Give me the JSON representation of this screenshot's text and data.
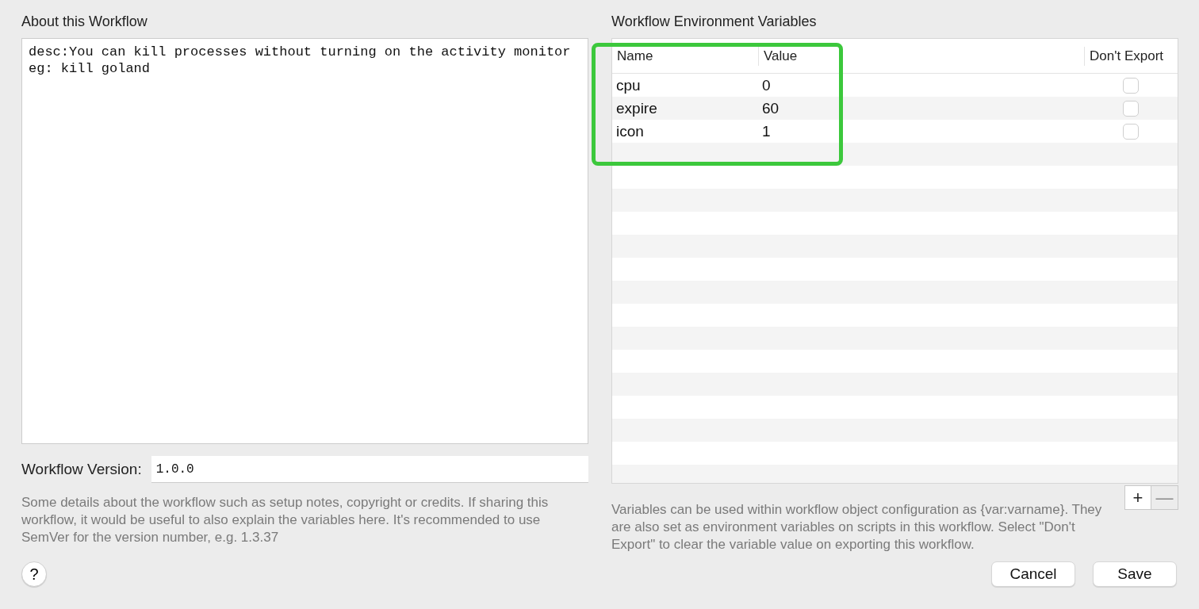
{
  "about": {
    "title": "About this Workflow",
    "text": "desc:You can kill processes without turning on the activity monitor\neg: kill goland"
  },
  "version": {
    "label": "Workflow Version:",
    "value": "1.0.0"
  },
  "about_note": "Some details about the workflow such as setup notes, copyright or credits. If sharing this workflow, it would be useful to also explain the variables here. It's recommended to use SemVer for the version number, e.g. 1.3.37",
  "help_button": "?",
  "variables": {
    "title": "Workflow Environment Variables",
    "columns": [
      "Name",
      "Value",
      "Don't Export"
    ],
    "rows": [
      {
        "name": "cpu",
        "value": "0",
        "dont_export": false
      },
      {
        "name": "expire",
        "value": "60",
        "dont_export": false
      },
      {
        "name": "icon",
        "value": "1",
        "dont_export": false
      }
    ]
  },
  "add_button": {
    "label": "+",
    "disabled": false
  },
  "remove_button": {
    "label": "—",
    "disabled": true
  },
  "variables_note": "Variables can be used within workflow object configuration as {var:varname}. They are also set as environment variables on scripts in this workflow. Select \"Don't Export\" to clear the variable value on exporting this workflow.",
  "buttons": [
    "Cancel",
    "Save"
  ]
}
